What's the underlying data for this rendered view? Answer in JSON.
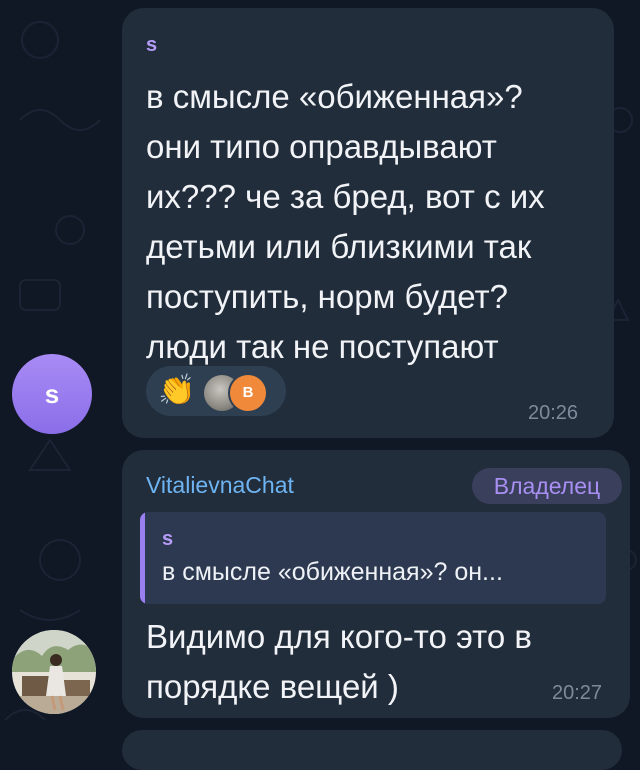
{
  "message_1": {
    "sender_initial": "s",
    "avatar_letter": "s",
    "text": "в смысле «обиженная»?\nони  типо оправдывают\nих??? че за бред, вот с их\nдетьми или близкими так\nпоступить, норм будет?\nлюди так не поступают",
    "reactions": {
      "emoji": "👏",
      "badge_letter": "B"
    },
    "time": "20:26"
  },
  "message_2": {
    "sender": "VitalievnaChat",
    "badge": "Владелец",
    "reply": {
      "author": "s",
      "text": "в смысле «обиженная»? он..."
    },
    "text": "Видимо для кого-то это в\nпорядке вещей )",
    "time": "20:27"
  },
  "colors": {
    "background": "#101826",
    "bubble": "#212d3b",
    "accent_purple": "#b59cf8",
    "name_blue": "#6fb4f2",
    "time_gray": "#7d8a99"
  }
}
